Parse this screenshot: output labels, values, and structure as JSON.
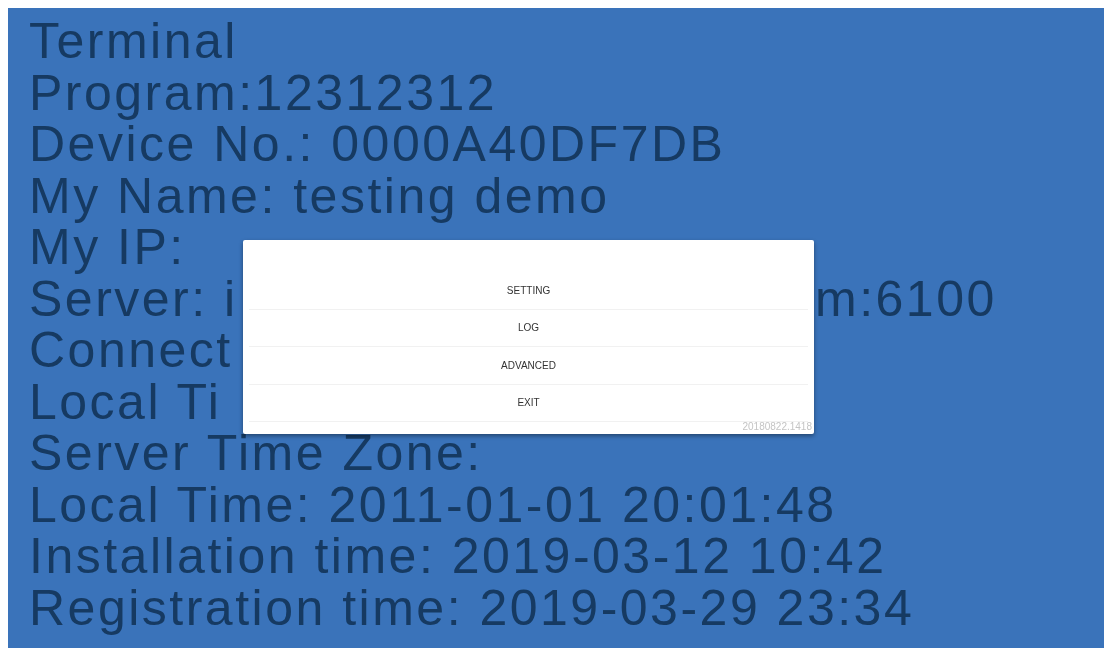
{
  "info_lines": [
    {
      "text": "Terminal"
    },
    {
      "text": "Program:12312312"
    },
    {
      "text": "Device No.: 0000A40DF7DB"
    },
    {
      "text": "My Name: testing demo"
    },
    {
      "text": "My IP:"
    },
    {
      "text": "Server: i",
      "tail": "m:6100"
    },
    {
      "text": "Connect"
    },
    {
      "text": "Local Ti"
    },
    {
      "text": "Server Time Zone:"
    },
    {
      "text": "Local Time: 2011-01-01 20:01:48"
    },
    {
      "text": "Installation time: 2019-03-12 10:42"
    },
    {
      "text": "Registration time: 2019-03-29 23:34"
    }
  ],
  "menu_dialog": {
    "items": [
      "SETTING",
      "LOG",
      "ADVANCED",
      "EXIT"
    ],
    "version": "20180822.1418"
  }
}
